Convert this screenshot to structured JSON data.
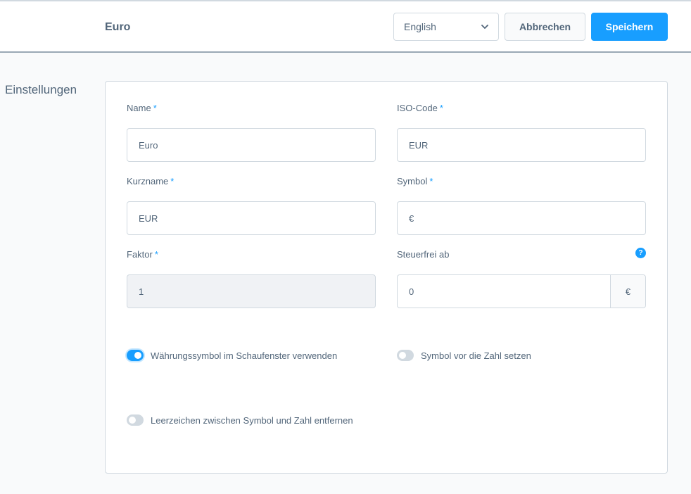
{
  "header": {
    "title": "Euro",
    "language_select": {
      "value": "English"
    },
    "cancel_label": "Abbrechen",
    "save_label": "Speichern"
  },
  "section": {
    "label": "Einstellungen"
  },
  "fields": {
    "name": {
      "label": "Name",
      "required": "*",
      "value": "Euro"
    },
    "iso_code": {
      "label": "ISO-Code",
      "required": "*",
      "value": "EUR"
    },
    "short_name": {
      "label": "Kurzname",
      "required": "*",
      "value": "EUR"
    },
    "symbol": {
      "label": "Symbol",
      "required": "*",
      "value": "€"
    },
    "factor": {
      "label": "Faktor",
      "required": "*",
      "value": "1"
    },
    "tax_free_from": {
      "label": "Steuerfrei ab",
      "value": "0",
      "suffix": "€",
      "help": "?"
    }
  },
  "toggles": {
    "use_symbol_storefront": {
      "label": "Währungssymbol im Schaufenster verwenden",
      "checked": true
    },
    "symbol_before_number": {
      "label": "Symbol vor die Zahl setzen",
      "checked": false
    },
    "remove_space": {
      "label": "Leerzeichen zwischen Symbol und Zahl entfernen",
      "checked": false
    }
  },
  "colors": {
    "accent": "#189eff",
    "text": "#52667a",
    "border": "#d1d9e0"
  }
}
